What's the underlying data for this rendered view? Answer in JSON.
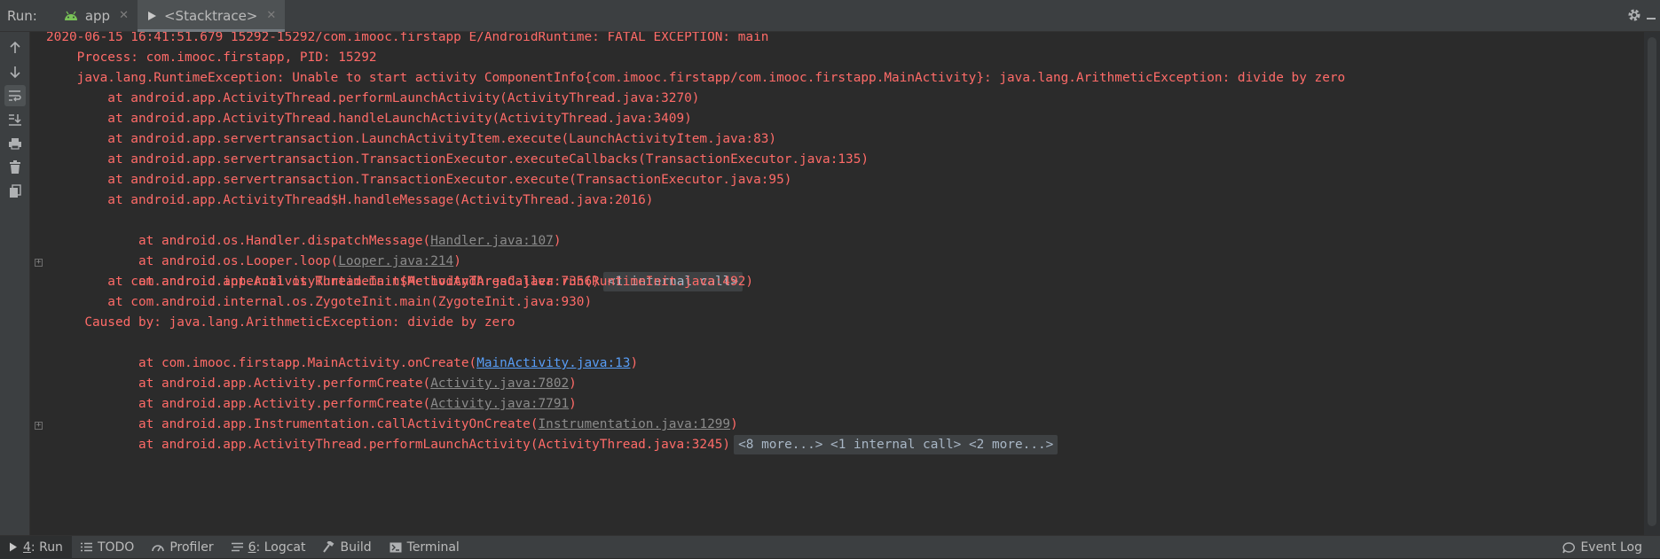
{
  "colors": {
    "error_text": "#ff6b68",
    "link_blue": "#589df6",
    "link_gray": "#8b8b8b",
    "background": "#2b2b2b",
    "panel": "#3c3f41"
  },
  "topbar": {
    "run_label": "Run:",
    "tabs": [
      {
        "label": "app",
        "icon": "android-icon",
        "active": false
      },
      {
        "label": "<Stacktrace>",
        "icon": "play-icon",
        "active": true
      }
    ],
    "close_glyph": "✕"
  },
  "lefttoolbar": {
    "buttons": [
      "up-arrow-icon",
      "down-arrow-icon",
      "soft-wrap-icon",
      "scroll-to-end-icon",
      "print-icon",
      "trash-icon",
      "copy-icon"
    ]
  },
  "console": {
    "lines": [
      {
        "text": "2020-06-15 16:41:51.679 15292-15292/com.imooc.firstapp E/AndroidRuntime: FATAL EXCEPTION: main"
      },
      {
        "text": "    Process: com.imooc.firstapp, PID: 15292"
      },
      {
        "text": "    java.lang.RuntimeException: Unable to start activity ComponentInfo{com.imooc.firstapp/com.imooc.firstapp.MainActivity}: java.lang.ArithmeticException: divide by zero"
      },
      {
        "text": "        at android.app.ActivityThread.performLaunchActivity(ActivityThread.java:3270)"
      },
      {
        "text": "        at android.app.ActivityThread.handleLaunchActivity(ActivityThread.java:3409)"
      },
      {
        "text": "        at android.app.servertransaction.LaunchActivityItem.execute(LaunchActivityItem.java:83)"
      },
      {
        "text": "        at android.app.servertransaction.TransactionExecutor.executeCallbacks(TransactionExecutor.java:135)"
      },
      {
        "text": "        at android.app.servertransaction.TransactionExecutor.execute(TransactionExecutor.java:95)"
      },
      {
        "text": "        at android.app.ActivityThread$H.handleMessage(ActivityThread.java:2016)"
      },
      {
        "prefix": "        at android.os.Handler.dispatchMessage(",
        "link": "Handler.java:107",
        "suffix": ")"
      },
      {
        "prefix": "        at android.os.Looper.loop(",
        "link": "Looper.java:214",
        "suffix": ")"
      },
      {
        "text": "        at android.app.ActivityThread.main(ActivityThread.java:7356)",
        "fold": "<1 internal call>"
      },
      {
        "text": "        at com.android.internal.os.RuntimeInit$MethodAndArgsCaller.run(RuntimeInit.java:492)"
      },
      {
        "text": "        at com.android.internal.os.ZygoteInit.main(ZygoteInit.java:930)"
      },
      {
        "text": "     Caused by: java.lang.ArithmeticException: divide by zero"
      },
      {
        "prefix": "        at com.imooc.firstapp.MainActivity.onCreate(",
        "link": "MainActivity.java:13",
        "suffix": ")",
        "blue": true
      },
      {
        "prefix": "        at android.app.Activity.performCreate(",
        "link": "Activity.java:7802",
        "suffix": ")"
      },
      {
        "prefix": "        at android.app.Activity.performCreate(",
        "link": "Activity.java:7791",
        "suffix": ")"
      },
      {
        "prefix": "        at android.app.Instrumentation.callActivityOnCreate(",
        "link": "Instrumentation.java:1299",
        "suffix": ")"
      },
      {
        "text": "        at android.app.ActivityThread.performLaunchActivity(ActivityThread.java:3245)",
        "fold": "<8 more...> <1 internal call> <2 more...>"
      }
    ]
  },
  "bottombar": {
    "items": [
      {
        "num": "4",
        "label": ": Run",
        "icon": "run-icon",
        "active": true
      },
      {
        "num": "",
        "label": "TODO",
        "icon": "todo-icon",
        "active": false
      },
      {
        "num": "",
        "label": "Profiler",
        "icon": "profiler-icon",
        "active": false
      },
      {
        "num": "6",
        "label": ": Logcat",
        "icon": "logcat-icon",
        "active": false
      },
      {
        "num": "",
        "label": "Build",
        "icon": "hammer-icon",
        "active": false
      },
      {
        "num": "",
        "label": "Terminal",
        "icon": "terminal-icon",
        "active": false
      }
    ],
    "event_log": "Event Log"
  }
}
